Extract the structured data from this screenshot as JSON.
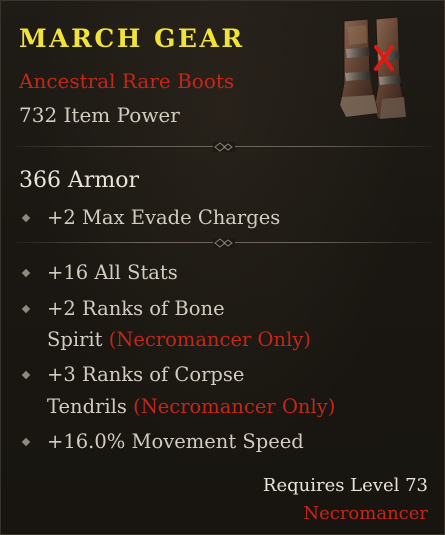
{
  "item": {
    "name": "MARCH GEAR",
    "type": "Ancestral Rare Boots",
    "item_power": "732 Item Power",
    "armor": "366 Armor",
    "implicit": "+2 Max Evade Charges",
    "affixes": [
      {
        "line1": "+16 All Stats"
      },
      {
        "line1": "+2 Ranks of Bone",
        "line2": "Spirit",
        "tag": "(Necromancer Only)"
      },
      {
        "line1": "+3 Ranks of Corpse",
        "line2": "Tendrils",
        "tag": "(Necromancer Only)"
      },
      {
        "line1": "+16.0% Movement Speed"
      }
    ],
    "requires": "Requires Level 73",
    "class": "Necromancer"
  },
  "icons": {
    "item_image": "boots-icon",
    "unusable_marker": "red-x-icon",
    "bullet": "diamond-bullet-icon"
  },
  "colors": {
    "title": "#f0e43a",
    "rarity": "#c5261b",
    "class_restriction": "#c5261b",
    "text": "#d3ccc0",
    "background": "#1b1813"
  }
}
